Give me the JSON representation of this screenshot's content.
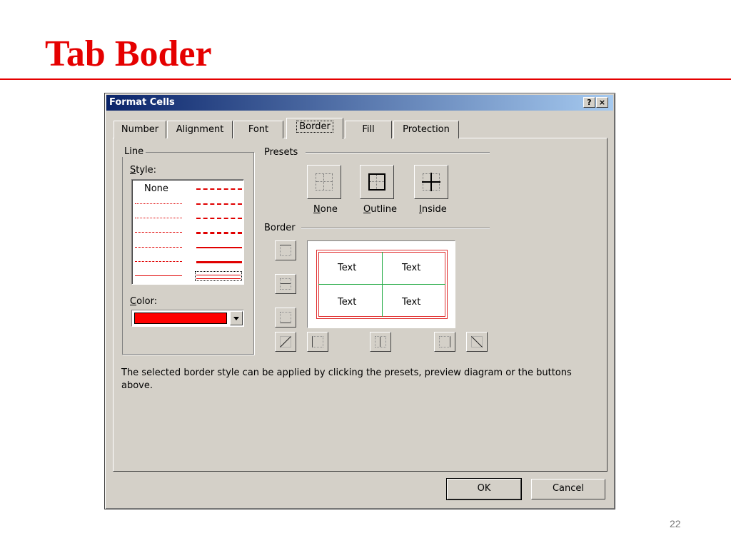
{
  "slide": {
    "title": "Tab Boder",
    "page_number": "22"
  },
  "dialog": {
    "title": "Format Cells",
    "help_glyph": "?",
    "close_glyph": "×",
    "tabs": [
      {
        "label": "Number"
      },
      {
        "label": "Alignment"
      },
      {
        "label": "Font"
      },
      {
        "label": "Border"
      },
      {
        "label": "Fill"
      },
      {
        "label": "Protection"
      }
    ],
    "active_tab": "Border",
    "line_group": {
      "legend": "Line",
      "style_label_key": "S",
      "style_label_rest": "tyle:",
      "style_none": "None",
      "color_label_key": "C",
      "color_label_rest": "olor:",
      "selected_color": "#ff0000"
    },
    "presets": {
      "legend": "Presets",
      "items": [
        {
          "key": "N",
          "rest": "one"
        },
        {
          "key": "O",
          "rest": "utline"
        },
        {
          "key": "I",
          "rest": "nside"
        }
      ]
    },
    "border": {
      "legend": "Border",
      "preview_cells": [
        "Text",
        "Text",
        "Text",
        "Text"
      ],
      "border_color": "#e03030",
      "inside_color": "#22aa44"
    },
    "description": "The selected border style can be applied by clicking the presets, preview diagram or the buttons above.",
    "buttons": {
      "ok": "OK",
      "cancel": "Cancel"
    }
  }
}
